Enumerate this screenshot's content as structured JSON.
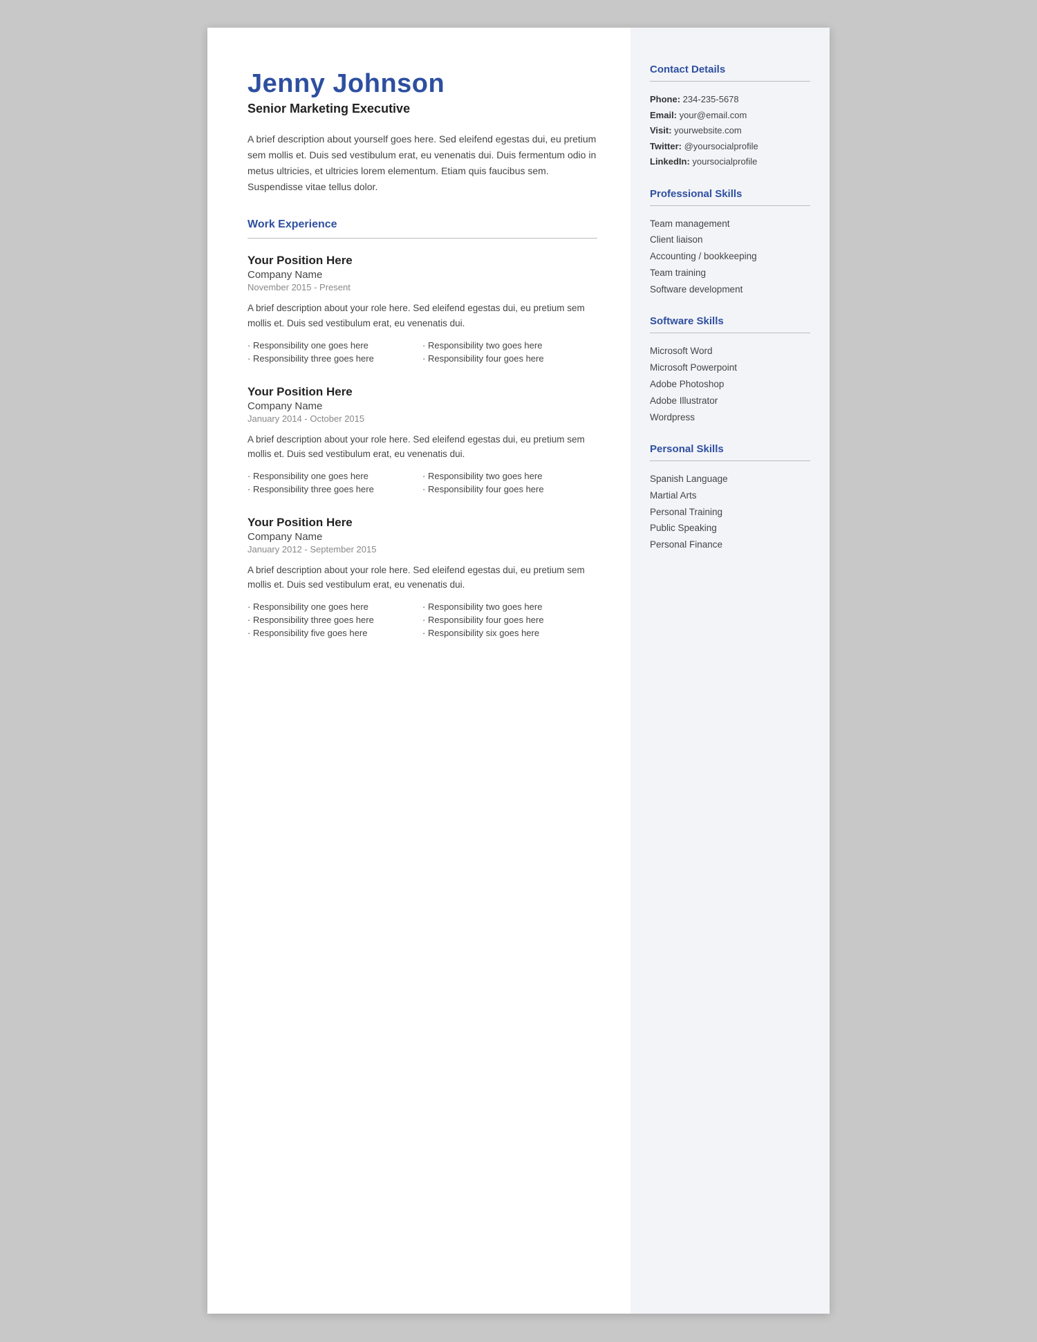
{
  "header": {
    "name": "Jenny Johnson",
    "title": "Senior Marketing Executive",
    "bio": "A brief description about yourself goes here. Sed eleifend egestas dui, eu pretium sem mollis et. Duis sed vestibulum erat, eu venenatis dui. Duis fermentum odio in metus ultricies, et ultricies lorem elementum. Etiam quis faucibus sem. Suspendisse vitae tellus dolor."
  },
  "work_experience": {
    "heading": "Work Experience",
    "jobs": [
      {
        "title": "Your Position Here",
        "company": "Company Name",
        "dates": "November 2015 - Present",
        "description": "A brief description about your role here. Sed eleifend egestas dui, eu pretium sem mollis et. Duis sed vestibulum erat, eu venenatis dui.",
        "responsibilities": [
          "Responsibility one goes here",
          "Responsibility two goes here",
          "Responsibility three goes here",
          "Responsibility four goes here"
        ]
      },
      {
        "title": "Your Position Here",
        "company": "Company Name",
        "dates": "January 2014 - October 2015",
        "description": "A brief description about your role here. Sed eleifend egestas dui, eu pretium sem mollis et. Duis sed vestibulum erat, eu venenatis dui.",
        "responsibilities": [
          "Responsibility one goes here",
          "Responsibility two goes here",
          "Responsibility three goes here",
          "Responsibility four goes here"
        ]
      },
      {
        "title": "Your Position Here",
        "company": "Company Name",
        "dates": "January 2012 - September 2015",
        "description": "A brief description about your role here. Sed eleifend egestas dui, eu pretium sem mollis et. Duis sed vestibulum erat, eu venenatis dui.",
        "responsibilities": [
          "Responsibility one goes here",
          "Responsibility two goes here",
          "Responsibility three goes here",
          "Responsibility four goes here",
          "Responsibility five goes here",
          "Responsibility six goes here"
        ]
      }
    ]
  },
  "sidebar": {
    "contact": {
      "heading": "Contact Details",
      "items": [
        {
          "label": "Phone:",
          "value": "234-235-5678"
        },
        {
          "label": "Email:",
          "value": "your@email.com"
        },
        {
          "label": "Visit:",
          "value": " yourwebsite.com"
        },
        {
          "label": "Twitter:",
          "value": "@yoursocialprofile"
        },
        {
          "label": "LinkedIn:",
          "value": "yoursocialprofile"
        }
      ]
    },
    "professional_skills": {
      "heading": "Professional Skills",
      "items": [
        "Team management",
        "Client liaison",
        "Accounting / bookkeeping",
        "Team training",
        "Software development"
      ]
    },
    "software_skills": {
      "heading": "Software Skills",
      "items": [
        "Microsoft Word",
        "Microsoft Powerpoint",
        "Adobe Photoshop",
        "Adobe Illustrator",
        "Wordpress"
      ]
    },
    "personal_skills": {
      "heading": "Personal Skills",
      "items": [
        "Spanish Language",
        "Martial Arts",
        "Personal Training",
        "Public Speaking",
        "Personal Finance"
      ]
    }
  }
}
